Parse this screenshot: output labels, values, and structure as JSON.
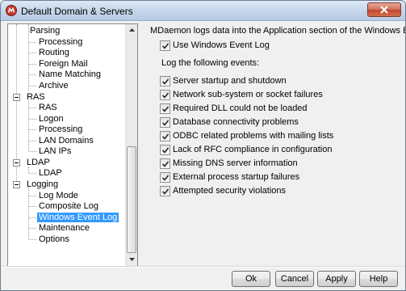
{
  "window": {
    "title": "Default Domain & Servers"
  },
  "tree": {
    "items": [
      {
        "label": "Parsing"
      },
      {
        "label": "Processing"
      },
      {
        "label": "Routing"
      },
      {
        "label": "Foreign Mail"
      },
      {
        "label": "Name Matching"
      },
      {
        "label": "Archive"
      },
      {
        "label": "RAS"
      },
      {
        "label": "RAS"
      },
      {
        "label": "Logon"
      },
      {
        "label": "Processing"
      },
      {
        "label": "LAN Domains"
      },
      {
        "label": "LAN IPs"
      },
      {
        "label": "LDAP"
      },
      {
        "label": "LDAP"
      },
      {
        "label": "Logging"
      },
      {
        "label": "Log Mode"
      },
      {
        "label": "Composite Log"
      },
      {
        "label": "Windows Event Log"
      },
      {
        "label": "Maintenance"
      },
      {
        "label": "Options"
      }
    ],
    "selected": "Windows Event Log"
  },
  "panel": {
    "intro": "MDaemon logs data into the Application section of the Windows Event Log.",
    "use_event_log": {
      "label": "Use Windows Event Log",
      "checked": true
    },
    "group_label": "Log the following events:",
    "events": [
      {
        "label": "Server startup and shutdown",
        "checked": true
      },
      {
        "label": "Network sub-system or socket failures",
        "checked": true
      },
      {
        "label": "Required DLL could not be loaded",
        "checked": true
      },
      {
        "label": "Database connectivity problems",
        "checked": true
      },
      {
        "label": "ODBC related problems with mailing lists",
        "checked": true
      },
      {
        "label": "Lack of RFC compliance in configuration",
        "checked": true
      },
      {
        "label": "Missing DNS server information",
        "checked": true
      },
      {
        "label": "External process startup failures",
        "checked": true
      },
      {
        "label": "Attempted security violations",
        "checked": true
      }
    ]
  },
  "buttons": {
    "ok": "Ok",
    "cancel": "Cancel",
    "apply": "Apply",
    "help": "Help"
  },
  "colors": {
    "selection": "#3399ff",
    "title_gradient_top": "#dde8f4",
    "close_red": "#c0452d"
  }
}
